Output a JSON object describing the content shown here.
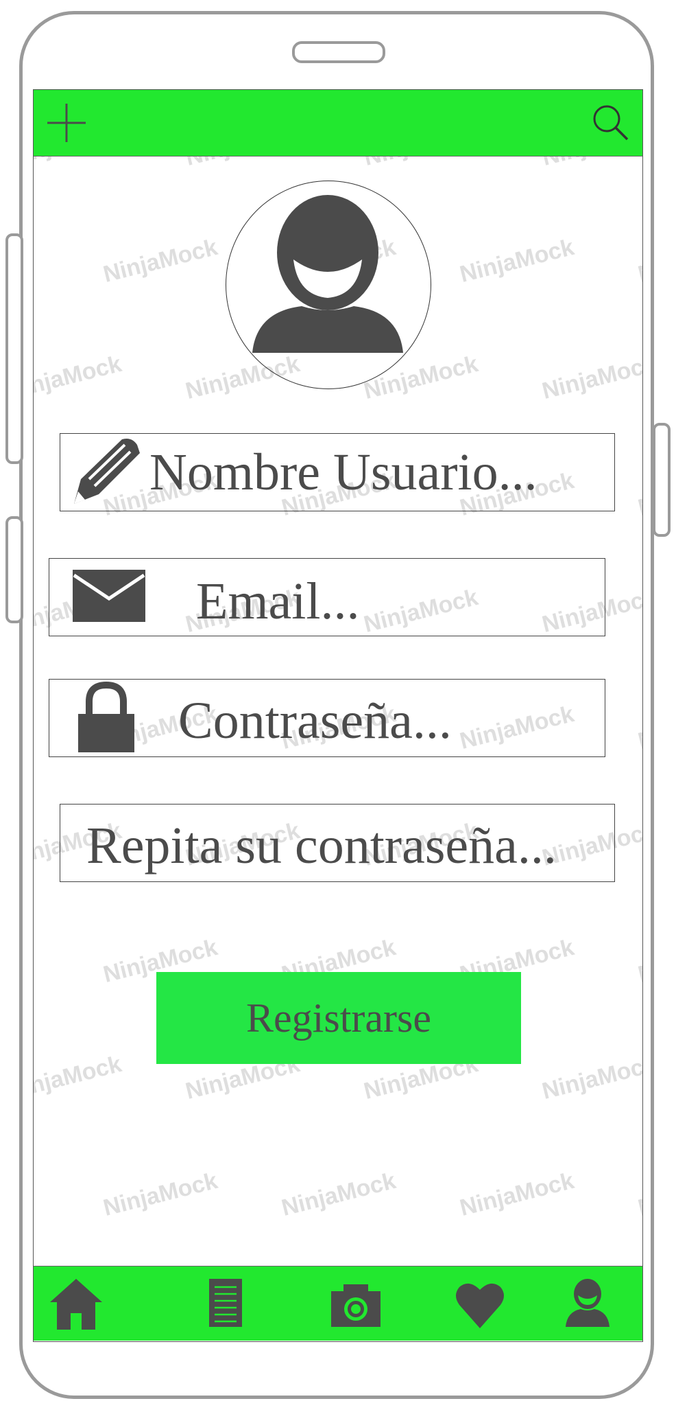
{
  "header": {
    "add_icon": "plus-icon",
    "search_icon": "search-icon"
  },
  "profile": {
    "avatar_icon": "user-avatar-icon"
  },
  "form": {
    "username_placeholder": "Nombre Usuario...",
    "email_placeholder": "Email...",
    "password_placeholder": "Contraseña...",
    "repeat_password_placeholder": "Repita su contraseña...",
    "submit_label": "Registrarse"
  },
  "bottom_nav": {
    "items": [
      "home-icon",
      "document-icon",
      "camera-icon",
      "heart-icon",
      "profile-icon"
    ]
  },
  "watermark": "NinjaMock",
  "colors": {
    "bar_green": "#22e82f",
    "button_green": "#24e645",
    "icon_gray": "#4b4b4b"
  }
}
